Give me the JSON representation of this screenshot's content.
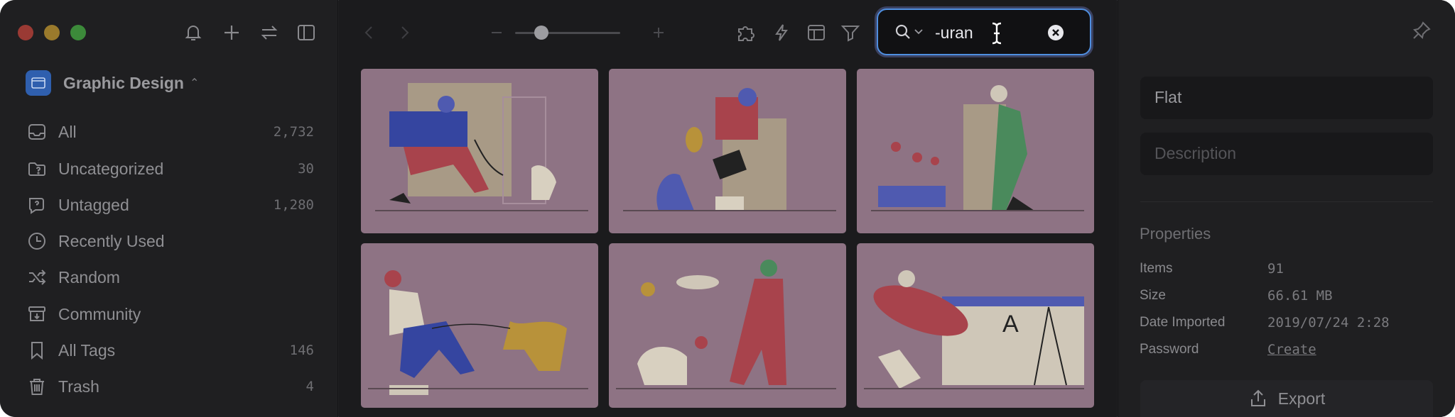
{
  "library": {
    "name": "Graphic Design",
    "icon": "library-icon"
  },
  "sidebar": {
    "items": [
      {
        "label": "All",
        "count": "2,732",
        "icon": "inbox-icon"
      },
      {
        "label": "Uncategorized",
        "count": "30",
        "icon": "folder-question-icon"
      },
      {
        "label": "Untagged",
        "count": "1,280",
        "icon": "tag-question-icon"
      },
      {
        "label": "Recently Used",
        "count": "",
        "icon": "clock-icon"
      },
      {
        "label": "Random",
        "count": "",
        "icon": "shuffle-icon"
      },
      {
        "label": "Community",
        "count": "",
        "icon": "archive-icon"
      },
      {
        "label": "All Tags",
        "count": "146",
        "icon": "bookmark-icon"
      },
      {
        "label": "Trash",
        "count": "4",
        "icon": "trash-icon"
      }
    ]
  },
  "toolbar": {
    "zoom_level": 0.25
  },
  "search": {
    "value": "-uran"
  },
  "inspector": {
    "name_value": "Flat",
    "description_placeholder": "Description",
    "properties_title": "Properties",
    "properties": [
      {
        "label": "Items",
        "value": "91"
      },
      {
        "label": "Size",
        "value": "66.61 MB"
      },
      {
        "label": "Date Imported",
        "value": "2019/07/24 2:28"
      },
      {
        "label": "Password",
        "value": "Create"
      }
    ],
    "export_label": "Export"
  },
  "colors": {
    "window_bg": "#202022",
    "sidebar_bg": "#1f1f21",
    "accent": "#4f8fe0",
    "thumb_bg": "#8e7384"
  }
}
